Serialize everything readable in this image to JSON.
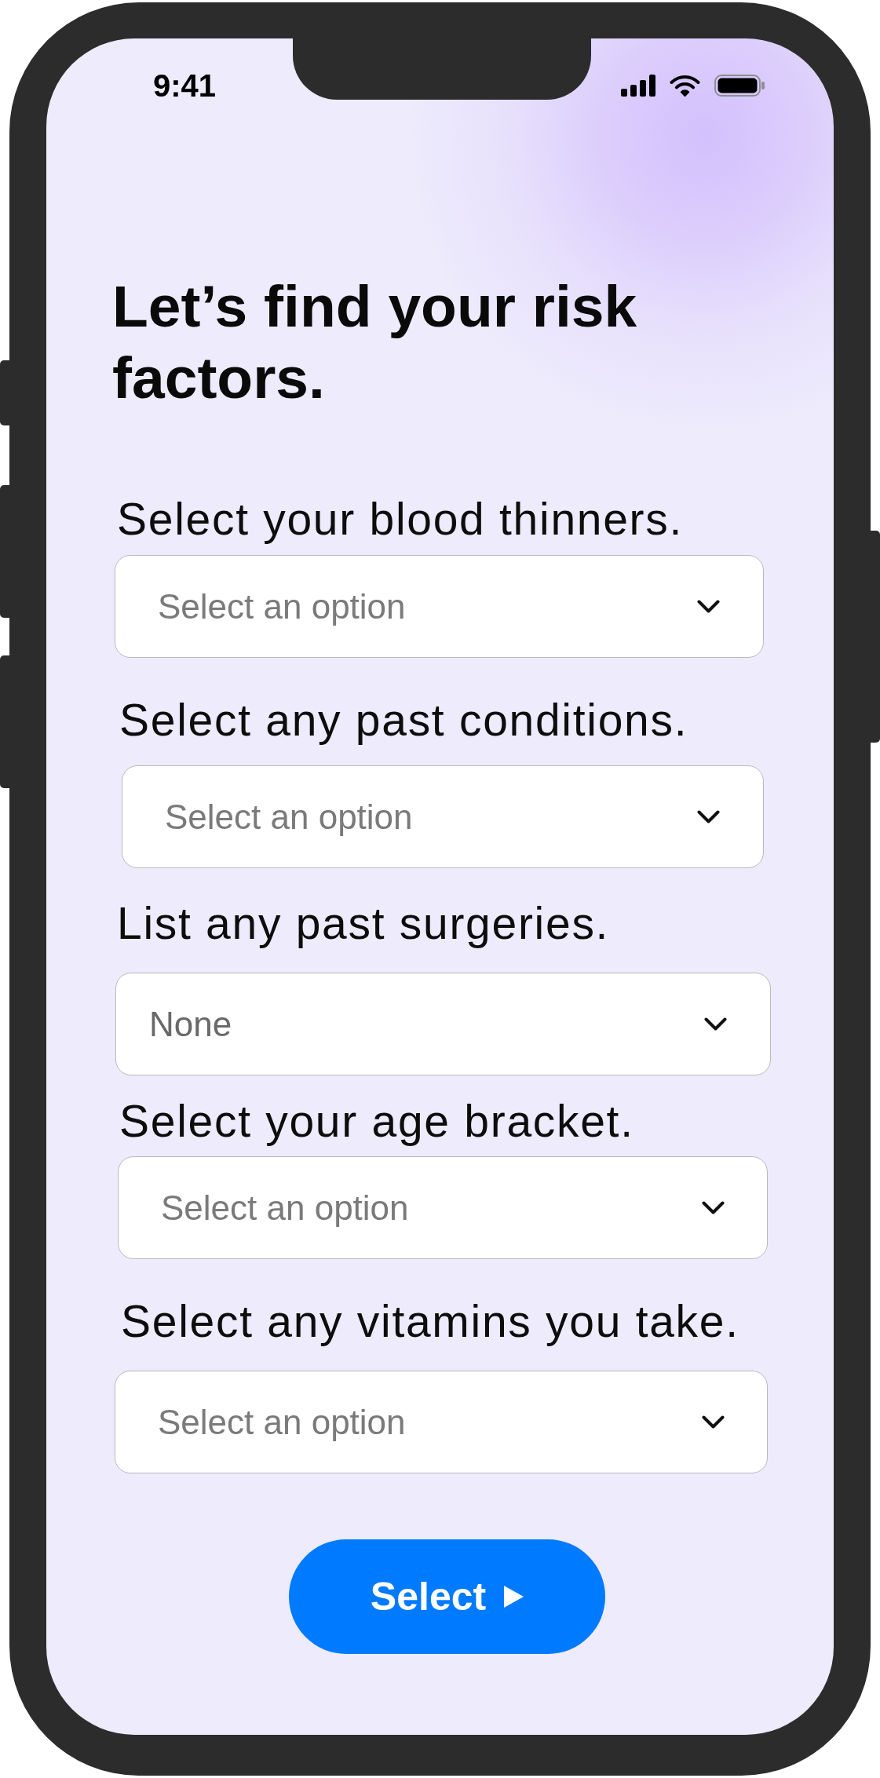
{
  "status_bar": {
    "time": "9:41"
  },
  "title": "Let’s find your risk factors.",
  "questions": [
    {
      "label": "Select your blood thinners.",
      "dropdown": {
        "placeholder": "Select an option"
      }
    },
    {
      "label": "Select any past conditions.",
      "dropdown": {
        "placeholder": "Select an option"
      }
    },
    {
      "label": "List any past surgeries.",
      "dropdown": {
        "value": "None"
      }
    },
    {
      "label": "Select your age bracket.",
      "dropdown": {
        "placeholder": "Select an option"
      }
    },
    {
      "label": "Select any vitamins you take.",
      "dropdown": {
        "placeholder": "Select an option"
      }
    }
  ],
  "submit_button": {
    "label": "Select"
  }
}
